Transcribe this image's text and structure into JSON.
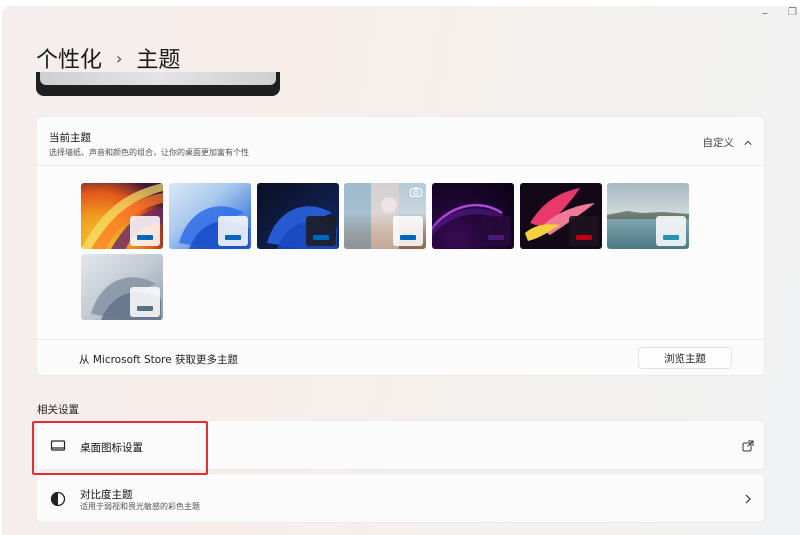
{
  "window": {
    "minimize_glyph": "–",
    "restore_glyph": "❐"
  },
  "breadcrumb": {
    "parent": "个性化",
    "separator": "›",
    "current": "主题"
  },
  "current_theme": {
    "title": "当前主题",
    "subtitle": "选择墙纸、声音和颜色的组合，让你的桌面更加富有个性",
    "custom_label": "自定义",
    "expanded": true,
    "themes": [
      {
        "id": "theme-1",
        "style": "flow-yellow",
        "accent": "#0067c0"
      },
      {
        "id": "theme-2",
        "style": "bloom-light",
        "accent": "#0067c0"
      },
      {
        "id": "theme-3",
        "style": "bloom-dark",
        "accent": "#0067c0"
      },
      {
        "id": "theme-4",
        "style": "spotlight",
        "accent": "#0067c0",
        "has_camera_icon": true
      },
      {
        "id": "theme-5",
        "style": "glow",
        "accent": "#4a1a7a"
      },
      {
        "id": "theme-6",
        "style": "captured-motion",
        "accent": "#c00012"
      },
      {
        "id": "theme-7",
        "style": "sunrise-lake",
        "accent": "#2f8fb0"
      },
      {
        "id": "theme-8",
        "style": "bloom-gray",
        "accent": "#5a6f82"
      }
    ],
    "store_text": "从 Microsoft Store 获取更多主题",
    "browse_button": "浏览主题"
  },
  "related": {
    "section_label": "相关设置",
    "desktop_icons": {
      "label": "桌面图标设置",
      "icon": "monitor-icon",
      "action_icon": "open-external-icon"
    },
    "contrast_themes": {
      "label": "对比度主题",
      "subtitle": "适用于弱视和畏光敏感的彩色主题",
      "icon": "contrast-icon",
      "action_icon": "chevron-right-icon"
    }
  },
  "colors": {
    "highlight": "#e23030",
    "accent": "#0067c0"
  }
}
